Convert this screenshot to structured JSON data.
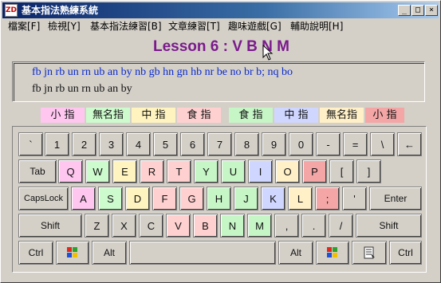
{
  "window": {
    "title": "基本指法熟練系統",
    "icon_label": "ZD"
  },
  "title_buttons": [
    {
      "name": "minimize-button",
      "glyph": "_"
    },
    {
      "name": "maximize-button",
      "glyph": "□"
    },
    {
      "name": "close-button",
      "glyph": "×"
    }
  ],
  "menu": [
    "檔案[F]",
    "檢視[Y]",
    "基本指法練習[B]",
    "文章練習[T]",
    "趣味遊戲[G]",
    "輔助說明[H]"
  ],
  "lesson_title": "Lesson 6 : V B N M",
  "practice": {
    "target": "fb jn rb un rn ub an by nb gb hn gn hb nr be no br b; nq bo",
    "typed": "fb jn rb un rn ub an by"
  },
  "fingers_left": [
    {
      "label": "小 指",
      "color": "#ffc6f0"
    },
    {
      "label": "無名指",
      "color": "#cdfbcd"
    },
    {
      "label": "中 指",
      "color": "#fff4c0"
    },
    {
      "label": "食 指",
      "color": "#ffd0d0"
    }
  ],
  "fingers_right": [
    {
      "label": "食 指",
      "color": "#c6f5c6"
    },
    {
      "label": "中 指",
      "color": "#cfd6ff"
    },
    {
      "label": "無名指",
      "color": "#fff0c8"
    },
    {
      "label": "小 指",
      "color": "#f4a6a6"
    }
  ],
  "colors": {
    "title": "#7b1a8c",
    "target_text": "#0a2ad0",
    "typed_text": "#111111",
    "highlight": "#c6f5c6"
  },
  "keyboard": {
    "row1": [
      "`",
      "1",
      "2",
      "3",
      "4",
      "5",
      "6",
      "7",
      "8",
      "9",
      "0",
      "-",
      "=",
      "\\",
      "←"
    ],
    "row2": [
      "Tab",
      "Q",
      "W",
      "E",
      "R",
      "T",
      "Y",
      "U",
      "I",
      "O",
      "P",
      "[",
      "]"
    ],
    "row3": [
      "CapsLock",
      "A",
      "S",
      "D",
      "F",
      "G",
      "H",
      "J",
      "K",
      "L",
      ";",
      "'",
      "Enter"
    ],
    "row4": [
      "Shift",
      "Z",
      "X",
      "C",
      "V",
      "B",
      "N",
      "M",
      ",",
      ".",
      "/",
      "Shift"
    ],
    "row5": [
      "Ctrl",
      "",
      "Alt",
      "",
      "Alt",
      "",
      "",
      "Ctrl"
    ]
  }
}
